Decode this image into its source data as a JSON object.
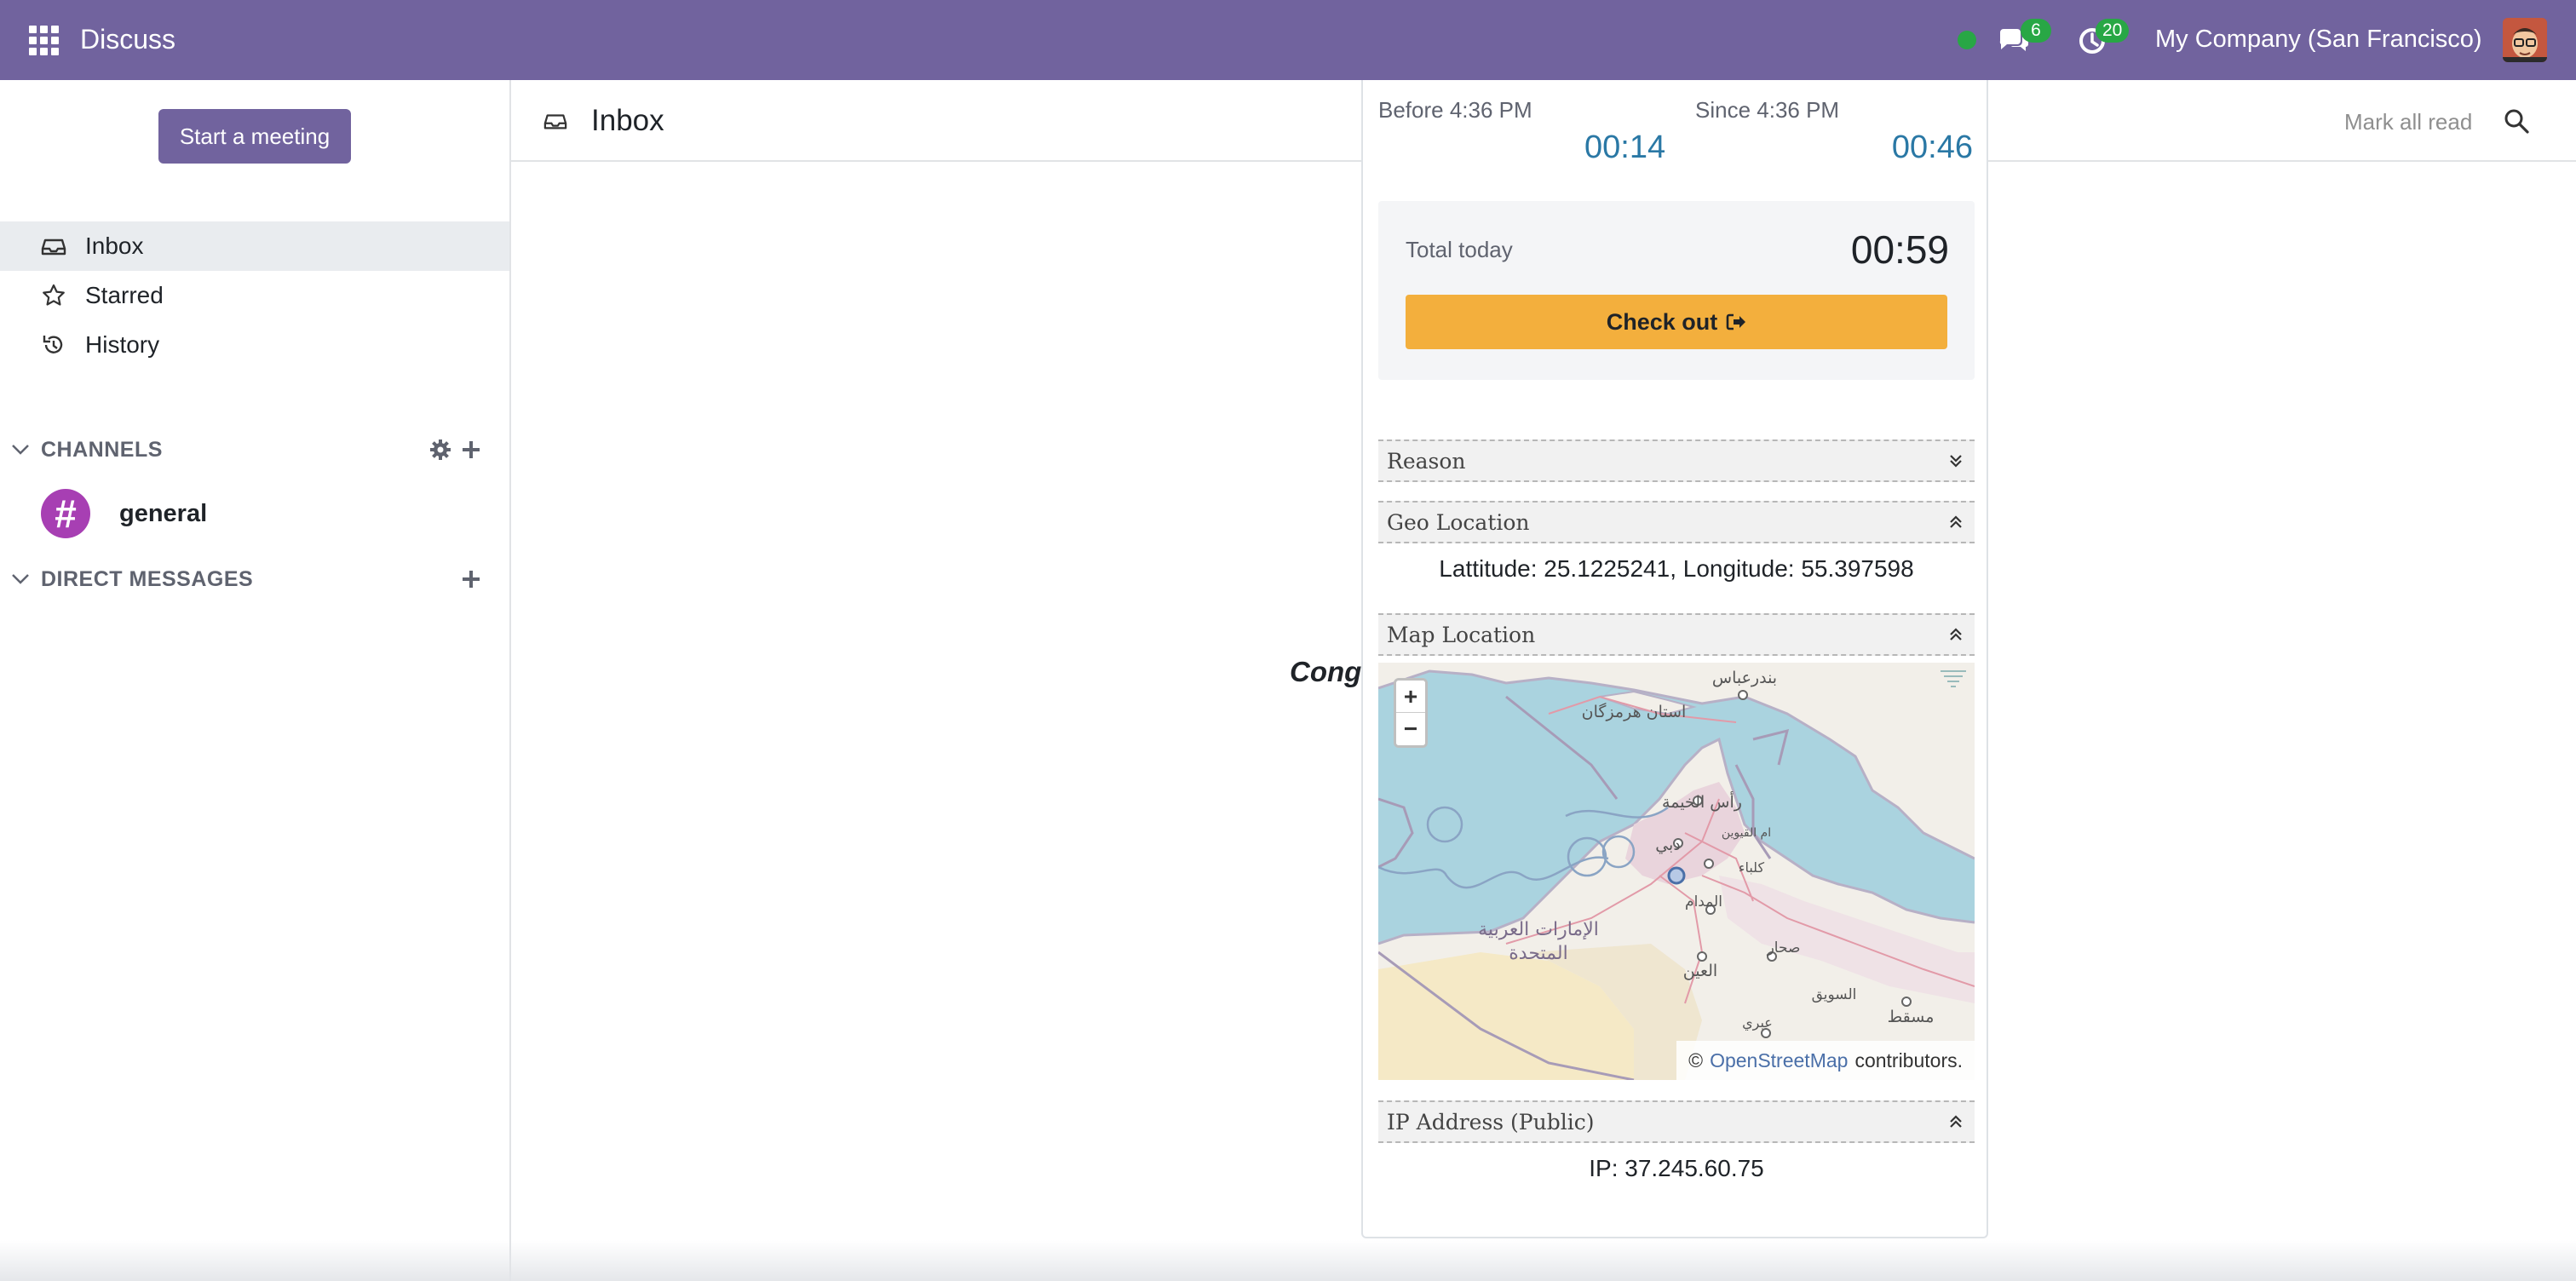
{
  "navbar": {
    "app_name": "Discuss",
    "messages_badge": "6",
    "activities_badge": "20",
    "company": "My Company (San Francisco)",
    "accent_color": "#71639e"
  },
  "sidebar": {
    "start_meeting_label": "Start a meeting",
    "items": [
      {
        "label": "Inbox",
        "icon": "inbox-icon",
        "active": true
      },
      {
        "label": "Starred",
        "icon": "star-icon",
        "active": false
      },
      {
        "label": "History",
        "icon": "history-icon",
        "active": false
      }
    ],
    "channels_title": "CHANNELS",
    "channels": [
      {
        "name": "general",
        "symbol": "#"
      }
    ],
    "direct_messages_title": "DIRECT MESSAGES"
  },
  "main": {
    "title": "Inbox",
    "mark_all_read": "Mark all read",
    "empty_text": "Cong"
  },
  "attendance": {
    "before_label": "Before 4:36 PM",
    "before_value": "00:14",
    "since_label": "Since 4:36 PM",
    "since_value": "00:46",
    "total_label": "Total today",
    "total_value": "00:59",
    "checkout_label": "Check out",
    "reason_title": "Reason",
    "geo_title": "Geo Location",
    "geo_text": "Lattitude: 25.1225241, Longitude: 55.397598",
    "map_title": "Map Location",
    "map_attribution_prefix": "©",
    "map_attribution_link": "OpenStreetMap",
    "map_attribution_suffix": "contributors.",
    "ip_title": "IP Address (Public)",
    "ip_text": "IP: 37.245.60.75",
    "zoom_in": "+",
    "zoom_out": "−",
    "map_labels": {
      "bandar_abbas": "بندرعباس",
      "hormozgan": "استان هرمزگان",
      "ras_al_khaimah": "رأس الخيمة",
      "umm_al_quwain": "ام القيوين",
      "dubai": "دبي",
      "kalba": "كلباء",
      "al_madam": "المدام",
      "uae_line1": "الإمارات العربية",
      "uae_line2": "المتحدة",
      "sohar": "صحار",
      "al_ain": "العين",
      "suwaiq": "السويق",
      "muscat": "مسقط",
      "ibri": "عبري"
    }
  }
}
